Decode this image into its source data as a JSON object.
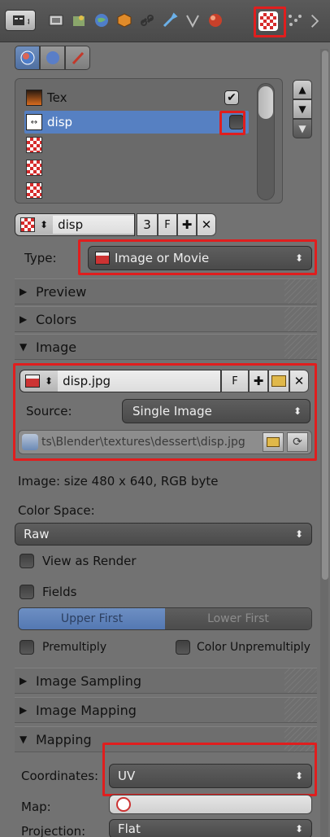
{
  "texture_list": {
    "items": [
      {
        "name": "Tex",
        "checked": true
      },
      {
        "name": "disp",
        "checked": false,
        "selected": true
      },
      {
        "name": ""
      },
      {
        "name": ""
      },
      {
        "name": ""
      }
    ]
  },
  "datablock": {
    "name": "disp",
    "users": "3",
    "fake_user": "F"
  },
  "type": {
    "label": "Type:",
    "value": "Image or Movie"
  },
  "panels": {
    "preview": "Preview",
    "colors": "Colors",
    "image": "Image",
    "image_sampling": "Image Sampling",
    "image_mapping": "Image Mapping",
    "mapping": "Mapping"
  },
  "image": {
    "name": "disp.jpg",
    "fake_user": "F",
    "source_label": "Source:",
    "source_value": "Single Image",
    "filepath": "ts\\Blender\\textures\\dessert\\disp.jpg",
    "info": "Image: size 480 x 640, RGB byte",
    "color_space_label": "Color Space:",
    "color_space_value": "Raw",
    "view_as_render": "View as Render",
    "fields": "Fields",
    "upper_first": "Upper First",
    "lower_first": "Lower First",
    "premultiply": "Premultiply",
    "color_unpremultiply": "Color Unpremultiply"
  },
  "mapping": {
    "coordinates_label": "Coordinates:",
    "coordinates_value": "UV",
    "map_label": "Map:",
    "projection_label": "Projection:",
    "projection_value": "Flat"
  },
  "colors": {
    "selected_row": "#5680c2",
    "highlight": "#e01e1e"
  }
}
